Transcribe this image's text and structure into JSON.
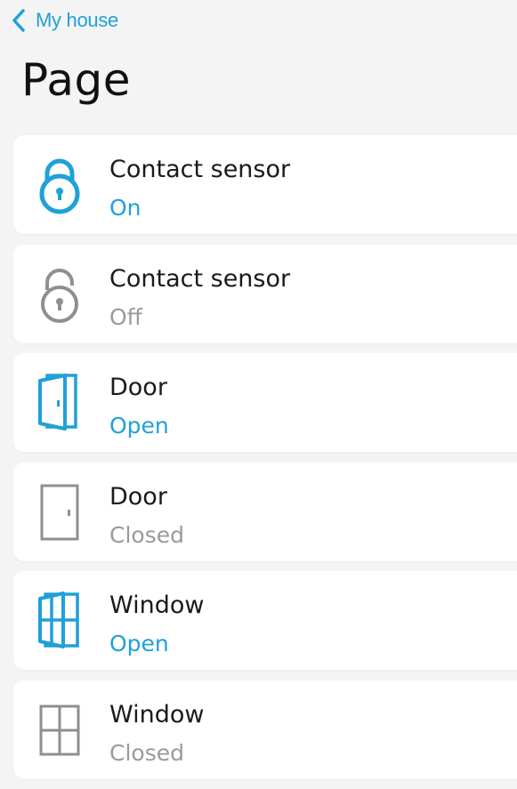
{
  "header": {
    "back_label": "My house",
    "title": "Page"
  },
  "colors": {
    "accent": "#1fa1d8",
    "inactive": "#9a9a9a",
    "inactive_icon": "#8f8f8f"
  },
  "items": [
    {
      "name": "Contact sensor",
      "state": "On",
      "icon": "lock-closed-icon",
      "active": true
    },
    {
      "name": "Contact sensor",
      "state": "Off",
      "icon": "lock-open-icon",
      "active": false
    },
    {
      "name": "Door",
      "state": "Open",
      "icon": "door-open-icon",
      "active": true
    },
    {
      "name": "Door",
      "state": "Closed",
      "icon": "door-closed-icon",
      "active": false
    },
    {
      "name": "Window",
      "state": "Open",
      "icon": "window-open-icon",
      "active": true
    },
    {
      "name": "Window",
      "state": "Closed",
      "icon": "window-closed-icon",
      "active": false
    }
  ]
}
